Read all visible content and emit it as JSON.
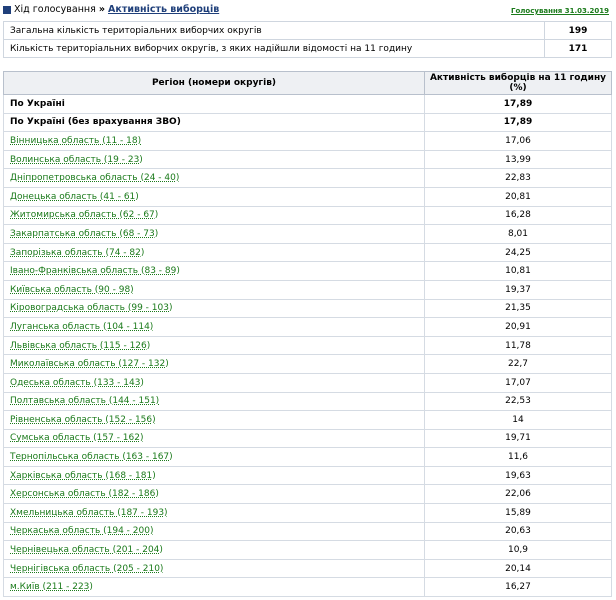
{
  "header": {
    "crumb": "Хід голосування",
    "separator": "»",
    "active": "Активність виборців",
    "date": "Голосування 31.03.2019"
  },
  "summary": [
    {
      "label": "Загальна кількість територіальних виборчих округів",
      "value": "199"
    },
    {
      "label": "Кількість територіальних виборчих округів, з яких надійшли відомості на 11 годину",
      "value": "171"
    }
  ],
  "table": {
    "col_region": "Регіон (номери округів)",
    "col_activity": "Активність виборців на 11 годину (%)",
    "rows": [
      {
        "region": "По Україні",
        "value": "17,89",
        "bold": true
      },
      {
        "region": "По Україні (без врахування ЗВО)",
        "value": "17,89",
        "bold": true
      },
      {
        "region": "Вінницька область (11 - 18)",
        "value": "17,06"
      },
      {
        "region": "Волинська область (19 - 23)",
        "value": "13,99"
      },
      {
        "region": "Дніпропетровська область (24 - 40)",
        "value": "22,83"
      },
      {
        "region": "Донецька область (41 - 61)",
        "value": "20,81"
      },
      {
        "region": "Житомирська область (62 - 67)",
        "value": "16,28"
      },
      {
        "region": "Закарпатська область (68 - 73)",
        "value": "8,01"
      },
      {
        "region": "Запорізька область (74 - 82)",
        "value": "24,25"
      },
      {
        "region": "Івано-Франківська область (83 - 89)",
        "value": "10,81"
      },
      {
        "region": "Київська область (90 - 98)",
        "value": "19,37"
      },
      {
        "region": "Кіровоградська область (99 - 103)",
        "value": "21,35"
      },
      {
        "region": "Луганська область (104 - 114)",
        "value": "20,91"
      },
      {
        "region": "Львівська область (115 - 126)",
        "value": "11,78"
      },
      {
        "region": "Миколаївська область (127 - 132)",
        "value": "22,7"
      },
      {
        "region": "Одеська область (133 - 143)",
        "value": "17,07"
      },
      {
        "region": "Полтавська область (144 - 151)",
        "value": "22,53"
      },
      {
        "region": "Рівненська область (152 - 156)",
        "value": "14"
      },
      {
        "region": "Сумська область (157 - 162)",
        "value": "19,71"
      },
      {
        "region": "Тернопільська область (163 - 167)",
        "value": "11,6"
      },
      {
        "region": "Харківська область (168 - 181)",
        "value": "19,63"
      },
      {
        "region": "Херсонська область (182 - 186)",
        "value": "22,06"
      },
      {
        "region": "Хмельницька область (187 - 193)",
        "value": "15,89"
      },
      {
        "region": "Черкаська область (194 - 200)",
        "value": "20,63"
      },
      {
        "region": "Чернівецька область (201 - 204)",
        "value": "10,9"
      },
      {
        "region": "Чернігівська область (205 - 210)",
        "value": "20,14"
      },
      {
        "region": "м.Київ (211 - 223)",
        "value": "16,27"
      }
    ]
  },
  "colors": {
    "link": "#1a7a1a",
    "nav": "#1f3f7a",
    "header_bg": "#eef0f3"
  }
}
